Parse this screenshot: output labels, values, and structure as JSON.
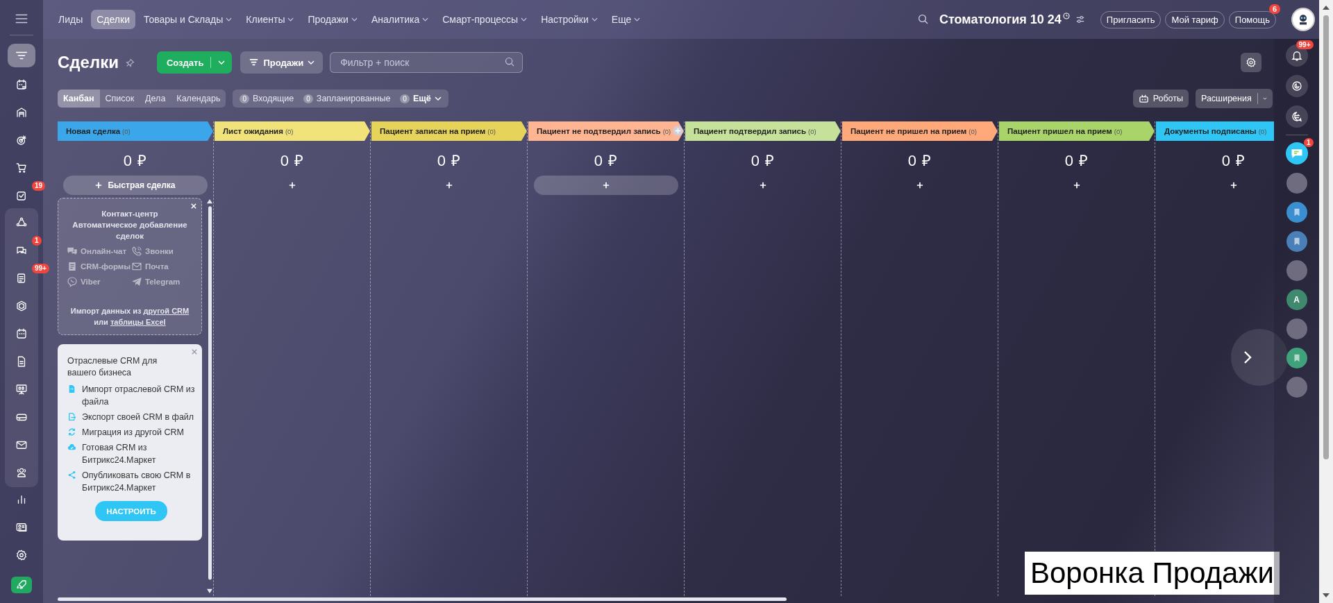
{
  "top_nav": {
    "menu": [
      {
        "label": "Лиды",
        "selected": false,
        "dropdown": false
      },
      {
        "label": "Сделки",
        "selected": true,
        "dropdown": false
      },
      {
        "label": "Товары и Склады",
        "selected": false,
        "dropdown": true
      },
      {
        "label": "Клиенты",
        "selected": false,
        "dropdown": true
      },
      {
        "label": "Продажи",
        "selected": false,
        "dropdown": true
      },
      {
        "label": "Аналитика",
        "selected": false,
        "dropdown": true
      },
      {
        "label": "Смарт-процессы",
        "selected": false,
        "dropdown": true
      },
      {
        "label": "Настройки",
        "selected": false,
        "dropdown": true
      },
      {
        "label": "Еще",
        "selected": false,
        "dropdown": true
      }
    ],
    "portal_title": "Стоматология 10 24",
    "buttons": [
      {
        "label": "Пригласить"
      },
      {
        "label": "Мой тариф"
      },
      {
        "label": "Помощь",
        "badge": "6"
      }
    ]
  },
  "left_sidebar": {
    "items": [
      {
        "selected": true
      },
      {
        "selected": false
      },
      {
        "selected": false
      },
      {
        "selected": false
      },
      {
        "selected": false
      },
      {
        "selected": false,
        "badge": "19"
      }
    ],
    "group_items": [
      {
        "selected": false
      },
      {
        "selected": false,
        "badge": "1"
      },
      {
        "selected": false,
        "badge": "99+"
      },
      {
        "selected": false
      },
      {
        "selected": false
      },
      {
        "selected": false
      },
      {
        "selected": false
      },
      {
        "selected": false
      },
      {
        "selected": false
      },
      {
        "selected": false
      }
    ],
    "bottom_items": [
      {
        "selected": false
      },
      {
        "selected": false
      },
      {
        "selected": false
      },
      {
        "selected": false
      }
    ]
  },
  "page": {
    "title": "Сделки",
    "create_button": "Создать",
    "pipeline_button": "Продажи",
    "search": {
      "placeholder": "Фильтр + поиск"
    }
  },
  "view_tabs": [
    {
      "label": "Канбан",
      "selected": true
    },
    {
      "label": "Список",
      "selected": false
    },
    {
      "label": "Дела",
      "selected": false
    },
    {
      "label": "Календарь",
      "selected": false
    }
  ],
  "counters": [
    {
      "count": "0",
      "label": "Входящие",
      "dropdown": false
    },
    {
      "count": "0",
      "label": "Запланированные",
      "dropdown": false
    },
    {
      "count": "0",
      "label": "Ещё",
      "dropdown": true
    }
  ],
  "robots_button": "Роботы",
  "extensions_button": "Расширения",
  "columns": [
    {
      "title": "Новая сделка",
      "count": "(0)",
      "color": "#3ba7ea",
      "sum": "0 ₽",
      "kind": "quick",
      "add_label": "Быстрая сделка"
    },
    {
      "title": "Лист ожидания",
      "count": "(0)",
      "color": "#f2e27a",
      "sum": "0 ₽",
      "kind": "plain"
    },
    {
      "title": "Пациент записан на прием",
      "count": "(0)",
      "color": "#e5d35a",
      "sum": "0 ₽",
      "kind": "plain"
    },
    {
      "title": "Пациент не подтвердил запись",
      "count": "(0)",
      "color": "#ffb591",
      "sum": "0 ₽",
      "kind": "pill"
    },
    {
      "title": "Пациент подтвердил запись",
      "count": "(0)",
      "color": "#c6e29a",
      "sum": "0 ₽",
      "kind": "plain"
    },
    {
      "title": "Пациент не пришел на прием",
      "count": "(0)",
      "color": "#ffa879",
      "sum": "0 ₽",
      "kind": "plain"
    },
    {
      "title": "Пациент пришел на прием",
      "count": "(0)",
      "color": "#a8d46a",
      "sum": "0 ₽",
      "kind": "plain"
    },
    {
      "title": "Документы подписаны",
      "count": "(0)",
      "color": "#2fc6f6",
      "sum": "0 ₽",
      "kind": "plain"
    }
  ],
  "contact_center": {
    "title": "Контакт-центр",
    "subtitle": "Автоматическое добавление сделок",
    "channels": [
      "Онлайн-чат",
      "Звонки",
      "CRM-формы",
      "Почта",
      "Viber",
      "Telegram"
    ],
    "import_prefix": "Импорт данных из",
    "import_link": "другой CRM",
    "import_middle": "или",
    "excel_link": "таблицы Excel"
  },
  "industry_card": {
    "title": "Отраслевые CRM для вашего бизнеса",
    "items": [
      "Импорт отраслевой CRM из файла",
      "Экспорт своей CRM в файл",
      "Миграция из другой CRM",
      "Готовая CRM из Битрикс24.Маркет",
      "Опубликовать свою CRM в Битрикс24.Маркет"
    ],
    "button": "НАСТРОИТЬ"
  },
  "right_sidebar": {
    "notifications_badge": "99+",
    "chat_badge": "1",
    "avatars": [
      {
        "kind": "photo"
      },
      {
        "kind": "icon",
        "color": "#3a8fd0"
      },
      {
        "kind": "icon",
        "color": "#4a7fb8"
      },
      {
        "kind": "photo"
      },
      {
        "kind": "initial",
        "text": "А",
        "color": "#3f8a6e"
      },
      {
        "kind": "photo"
      },
      {
        "kind": "icon",
        "color": "#3fa27a"
      },
      {
        "kind": "photo"
      }
    ]
  },
  "caption": "Воронка Продажи"
}
